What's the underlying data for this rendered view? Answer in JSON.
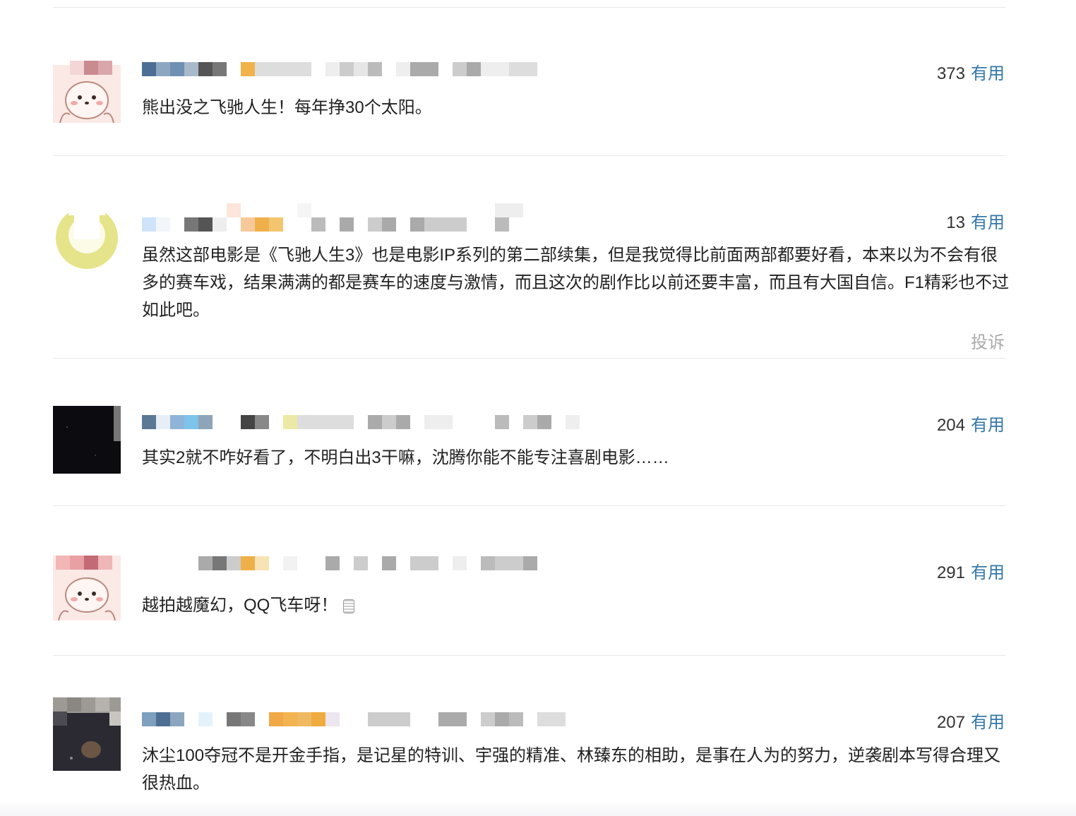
{
  "comments": [
    {
      "votes": "373",
      "useful_label": "有用",
      "text": "熊出没之飞驰人生！每年挣30个太阳。",
      "avatar": "pink-bear-avatar"
    },
    {
      "votes": "13",
      "useful_label": "有用",
      "text": "虽然这部电影是《飞驰人生3》也是电影IP系列的第二部续集，但是我觉得比前面两部都要好看，本来以为不会有很多的赛车戏，结果满满的都是赛车的速度与激情，而且这次的剧作比以前还要丰富，而且有大国自信。F1精彩也不过如此吧。",
      "report_label": "投诉",
      "avatar": "yellow-ring-avatar"
    },
    {
      "votes": "204",
      "useful_label": "有用",
      "text": "其实2就不咋好看了，不明白出3干嘛，沈腾你能不能专注喜剧电影……",
      "avatar": "dark-avatar"
    },
    {
      "votes": "291",
      "useful_label": "有用",
      "text": "越拍越魔幻，QQ飞车呀！",
      "avatar": "pink-bear-avatar"
    },
    {
      "votes": "207",
      "useful_label": "有用",
      "text": "沐尘100夺冠不是开金手指，是记星的特训、宇强的精准、林臻东的相助，是事在人为的努力，逆袭剧本写得合理又很热血。",
      "avatar": "dark-portrait-avatar"
    }
  ]
}
